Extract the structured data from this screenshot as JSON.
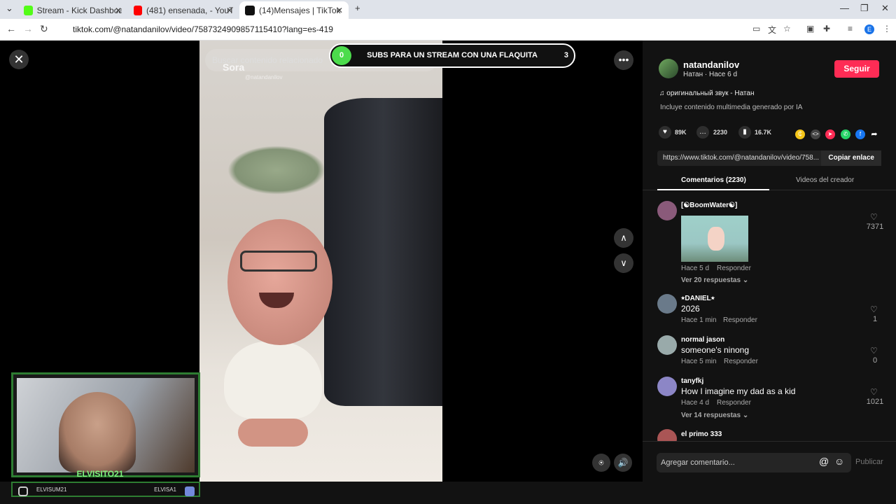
{
  "browser": {
    "tabs": [
      {
        "title": "Stream - Kick Dashboard",
        "favicon_color": "#53fc18"
      },
      {
        "title": "(481) ensenada, - YouTube",
        "favicon_color": "#ff0000"
      },
      {
        "title": "(14)Mensajes | TikTok",
        "favicon_color": "#111111"
      }
    ],
    "url": "tiktok.com/@natandanilov/video/7587324909857115410?lang=es-419",
    "new_tab": "+",
    "controls": {
      "minimize": "—",
      "restore": "❐",
      "close": "✕"
    }
  },
  "player": {
    "close": "✕",
    "search_placeholder": "Buscar contenido relacionado",
    "watermark": "Sora",
    "watermark_handle": "@natandanilov",
    "more": "•••",
    "arrow_up": "∧",
    "arrow_down": "∨",
    "report": "⍟",
    "volume": "🔊"
  },
  "overlay_banner": {
    "left_count": "0",
    "text": "SUBS PARA UN STREAM CON UNA FLAQUITA",
    "right_count": "3"
  },
  "webcam": {
    "name": "ELVISITO21",
    "social_left": "ELVISUM21",
    "social_right": "ELVISA1"
  },
  "creator": {
    "username": "natandanilov",
    "subtitle": "Натан · Hace 6 d",
    "follow": "Seguir",
    "sound": "оригинальный звук - Натан",
    "ai_note": "Incluye contenido multimedia generado por IA"
  },
  "stats": {
    "likes": "89K",
    "comments": "2230",
    "saves": "16.7K"
  },
  "link": {
    "url": "https://www.tiktok.com/@natandanilov/video/758...",
    "copy": "Copiar enlace"
  },
  "tabs": {
    "comments": "Comentarios (2230)",
    "videos": "Videos del creador"
  },
  "comments": [
    {
      "name": "[☯BoomWater☯]",
      "meta": "Hace 5 d",
      "reply": "Responder",
      "likes": "7371",
      "more": "Ver 20 respuestas ⌄"
    },
    {
      "name": "⭒DANIEL⭒",
      "text": "2026",
      "meta": "Hace 1 min",
      "reply": "Responder",
      "likes": "1"
    },
    {
      "name": "normal jason",
      "text": "someone's ninong",
      "meta": "Hace 5 min",
      "reply": "Responder",
      "likes": "0"
    },
    {
      "name": "tanyfkj",
      "text": "How I imagine my dad as a kid",
      "meta": "Hace 4 d",
      "reply": "Responder",
      "likes": "1021",
      "more": "Ver 14 respuestas ⌄"
    },
    {
      "name": "el primo 333"
    }
  ],
  "composer": {
    "placeholder": "Agregar comentario...",
    "at": "@",
    "emoji": "☺",
    "post": "Publicar"
  }
}
